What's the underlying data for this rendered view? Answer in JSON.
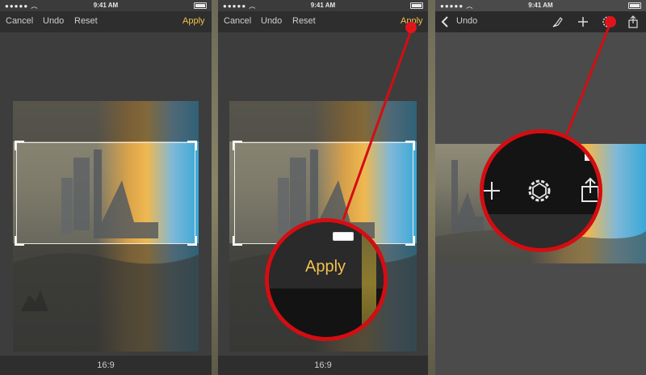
{
  "status": {
    "time": "9:41 AM"
  },
  "panel1": {
    "nav": {
      "cancel": "Cancel",
      "undo": "Undo",
      "reset": "Reset",
      "apply": "Apply"
    },
    "bottom": {
      "aspect": "16:9"
    }
  },
  "panel2": {
    "nav": {
      "cancel": "Cancel",
      "undo": "Undo",
      "reset": "Reset",
      "apply": "Apply"
    },
    "bottom": {
      "aspect": "16:9"
    },
    "zoom": {
      "apply": "Apply"
    }
  },
  "panel3": {
    "nav": {
      "undo": "Undo"
    },
    "icons": [
      "back-chevron-icon",
      "brush-icon",
      "plus-icon",
      "gear-icon",
      "share-icon"
    ]
  },
  "colors": {
    "accent": "#f2c14e",
    "annotation": "#d40d12"
  }
}
